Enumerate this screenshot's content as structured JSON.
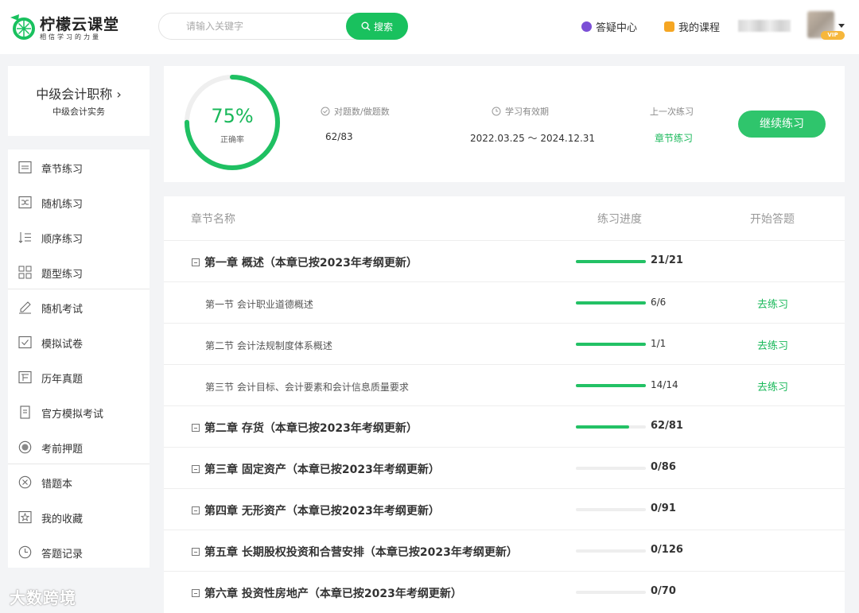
{
  "header": {
    "logo_text": "柠檬云课堂",
    "logo_slogan": "相信学习的力量",
    "search_placeholder": "请输入关键字",
    "search_button": "搜索",
    "nav_qa": "答疑中心",
    "nav_courses": "我的课程",
    "vip_badge": "VIP"
  },
  "colors": {
    "brand": "#19c15e",
    "progress": "#23c165",
    "link": "#19b85a"
  },
  "course": {
    "title": "中级会计职称",
    "subtitle": "中级会计实务"
  },
  "sidebar": {
    "items": [
      {
        "label": "章节练习",
        "icon": "chapter-icon"
      },
      {
        "label": "随机练习",
        "icon": "shuffle-icon"
      },
      {
        "label": "顺序练习",
        "icon": "sort-icon"
      },
      {
        "label": "题型练习",
        "icon": "grid-icon"
      },
      {
        "label": "随机考试",
        "icon": "pencil-icon"
      },
      {
        "label": "模拟试卷",
        "icon": "checkbox-icon"
      },
      {
        "label": "历年真题",
        "icon": "calendar-icon"
      },
      {
        "label": "官方模拟考试",
        "icon": "document-icon"
      },
      {
        "label": "考前押题",
        "icon": "target-icon"
      },
      {
        "label": "错题本",
        "icon": "cross-circle-icon"
      },
      {
        "label": "我的收藏",
        "icon": "star-icon"
      },
      {
        "label": "答题记录",
        "icon": "clock-icon"
      }
    ]
  },
  "stats": {
    "accuracy": "75%",
    "accuracy_fraction": 0.75,
    "accuracy_label": "正确率",
    "answered_label": "对题数/做题数",
    "answered_value": "62/83",
    "validity_label": "学习有效期",
    "validity_value": "2022.03.25 ～ 2024.12.31",
    "last_label": "上一次练习",
    "last_value": "章节练习",
    "continue_button": "继续练习"
  },
  "table": {
    "headers": {
      "name": "章节名称",
      "progress": "练习进度",
      "start": "开始答题"
    },
    "rows": [
      {
        "title": "第一章 概述（本章已按2023年考纲更新）",
        "kind": "chapter",
        "progress": 1.0,
        "count": "21/21",
        "action": ""
      },
      {
        "title": "第一节 会计职业道德概述",
        "kind": "section",
        "progress": 1.0,
        "count": "6/6",
        "action": "去练习"
      },
      {
        "title": "第二节 会计法规制度体系概述",
        "kind": "section",
        "progress": 1.0,
        "count": "1/1",
        "action": "去练习"
      },
      {
        "title": "第三节 会计目标、会计要素和会计信息质量要求",
        "kind": "section",
        "progress": 1.0,
        "count": "14/14",
        "action": "去练习"
      },
      {
        "title": "第二章 存货（本章已按2023年考纲更新）",
        "kind": "chapter",
        "progress": 0.765,
        "count": "62/81",
        "action": ""
      },
      {
        "title": "第三章 固定资产（本章已按2023年考纲更新）",
        "kind": "chapter",
        "progress": 0,
        "count": "0/86",
        "action": ""
      },
      {
        "title": "第四章 无形资产（本章已按2023年考纲更新）",
        "kind": "chapter",
        "progress": 0,
        "count": "0/91",
        "action": ""
      },
      {
        "title": "第五章 长期股权投资和合营安排（本章已按2023年考纲更新）",
        "kind": "chapter",
        "progress": 0,
        "count": "0/126",
        "action": ""
      },
      {
        "title": "第六章 投资性房地产（本章已按2023年考纲更新）",
        "kind": "chapter",
        "progress": 0,
        "count": "0/70",
        "action": ""
      }
    ]
  },
  "watermark": "大数跨境"
}
